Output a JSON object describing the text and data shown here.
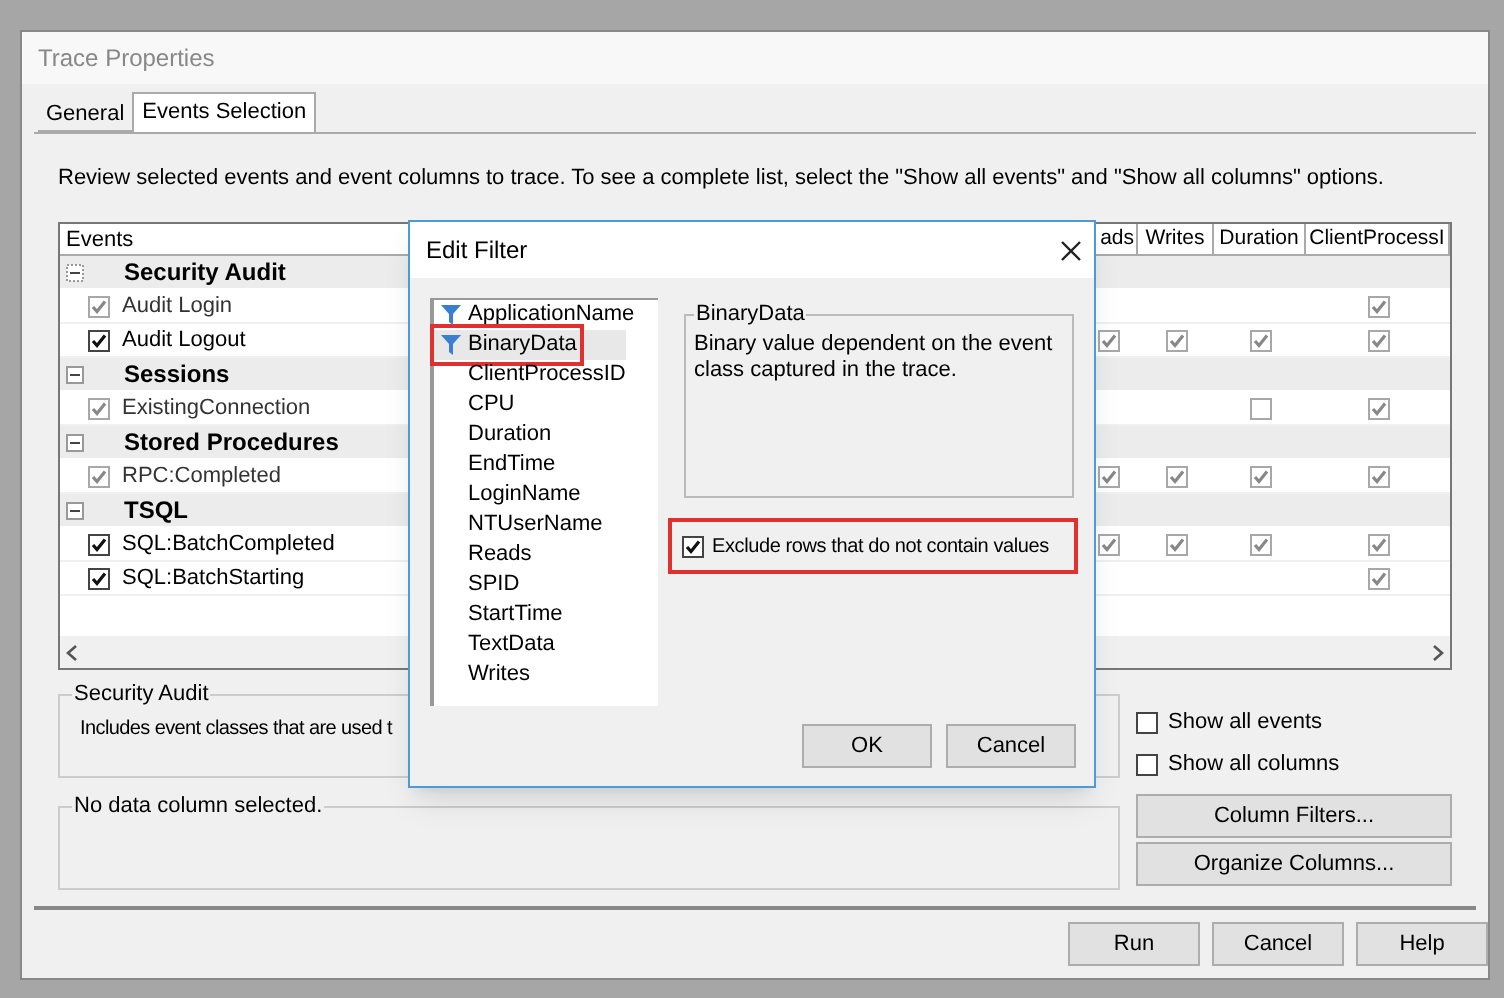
{
  "window": {
    "title": "Trace Properties"
  },
  "tabs": [
    {
      "label": "General",
      "selected": false
    },
    {
      "label": "Events Selection",
      "selected": true
    }
  ],
  "instructions": "Review selected events and event columns to trace. To see a complete list, select the \"Show all events\" and \"Show all columns\" options.",
  "events_grid": {
    "columns": [
      "Events",
      "ads",
      "Writes",
      "Duration",
      "ClientProcessI"
    ],
    "rows": [
      {
        "kind": "category",
        "label": "Security Audit",
        "expanded": true
      },
      {
        "kind": "event",
        "label": "Audit Login",
        "checked": true,
        "dimmed": true,
        "cells": [
          {
            "kind": "blank"
          },
          {
            "kind": "blank"
          },
          {
            "kind": "blank"
          },
          {
            "kind": "checkbox",
            "checked": true
          }
        ]
      },
      {
        "kind": "event",
        "label": "Audit Logout",
        "checked": true,
        "dimmed": false,
        "cells": [
          {
            "kind": "checkbox",
            "checked": true
          },
          {
            "kind": "checkbox",
            "checked": true
          },
          {
            "kind": "checkbox",
            "checked": true
          },
          {
            "kind": "checkbox",
            "checked": true
          }
        ]
      },
      {
        "kind": "category",
        "label": "Sessions",
        "expanded": true
      },
      {
        "kind": "event",
        "label": "ExistingConnection",
        "checked": true,
        "dimmed": true,
        "cells": [
          {
            "kind": "blank"
          },
          {
            "kind": "blank"
          },
          {
            "kind": "checkbox",
            "checked": false
          },
          {
            "kind": "checkbox",
            "checked": true
          }
        ]
      },
      {
        "kind": "category",
        "label": "Stored Procedures",
        "expanded": true
      },
      {
        "kind": "event",
        "label": "RPC:Completed",
        "checked": true,
        "dimmed": true,
        "cells": [
          {
            "kind": "checkbox",
            "checked": true
          },
          {
            "kind": "checkbox",
            "checked": true
          },
          {
            "kind": "checkbox",
            "checked": true
          },
          {
            "kind": "checkbox",
            "checked": true
          }
        ]
      },
      {
        "kind": "category",
        "label": "TSQL",
        "expanded": true
      },
      {
        "kind": "event",
        "label": "SQL:BatchCompleted",
        "checked": true,
        "dimmed": false,
        "cells": [
          {
            "kind": "checkbox",
            "checked": true
          },
          {
            "kind": "checkbox",
            "checked": true
          },
          {
            "kind": "checkbox",
            "checked": true
          },
          {
            "kind": "checkbox",
            "checked": true
          }
        ]
      },
      {
        "kind": "event",
        "label": "SQL:BatchStarting",
        "checked": true,
        "dimmed": false,
        "cells": [
          {
            "kind": "blank"
          },
          {
            "kind": "blank"
          },
          {
            "kind": "blank"
          },
          {
            "kind": "checkbox",
            "checked": true
          }
        ]
      }
    ]
  },
  "event_description": {
    "title": "Security Audit",
    "text": "Includes event classes that are used t"
  },
  "column_description": {
    "text": "No data column selected."
  },
  "options": [
    {
      "label": "Show all events",
      "checked": false
    },
    {
      "label": "Show all columns",
      "checked": false
    }
  ],
  "side_buttons": [
    "Column Filters...",
    "Organize Columns..."
  ],
  "footer_buttons": [
    "Run",
    "Cancel",
    "Help"
  ],
  "edit_filter": {
    "title": "Edit Filter",
    "columns": [
      {
        "label": "ApplicationName",
        "filtered": true,
        "selected": false,
        "highlighted": false
      },
      {
        "label": "BinaryData",
        "filtered": true,
        "selected": true,
        "highlighted": true
      },
      {
        "label": "ClientProcessID",
        "filtered": false,
        "selected": false,
        "highlighted": false
      },
      {
        "label": "CPU",
        "filtered": false,
        "selected": false,
        "highlighted": false
      },
      {
        "label": "Duration",
        "filtered": false,
        "selected": false,
        "highlighted": false
      },
      {
        "label": "EndTime",
        "filtered": false,
        "selected": false,
        "highlighted": false
      },
      {
        "label": "LoginName",
        "filtered": false,
        "selected": false,
        "highlighted": false
      },
      {
        "label": "NTUserName",
        "filtered": false,
        "selected": false,
        "highlighted": false
      },
      {
        "label": "Reads",
        "filtered": false,
        "selected": false,
        "highlighted": false
      },
      {
        "label": "SPID",
        "filtered": false,
        "selected": false,
        "highlighted": false
      },
      {
        "label": "StartTime",
        "filtered": false,
        "selected": false,
        "highlighted": false
      },
      {
        "label": "TextData",
        "filtered": false,
        "selected": false,
        "highlighted": false
      },
      {
        "label": "Writes",
        "filtered": false,
        "selected": false,
        "highlighted": false
      }
    ],
    "detail": {
      "title": "BinaryData",
      "text": "Binary value dependent on the event class captured in the trace."
    },
    "exclude": {
      "label": "Exclude rows that do not contain values",
      "checked": true,
      "highlighted": true
    },
    "buttons": [
      "OK",
      "Cancel"
    ]
  }
}
